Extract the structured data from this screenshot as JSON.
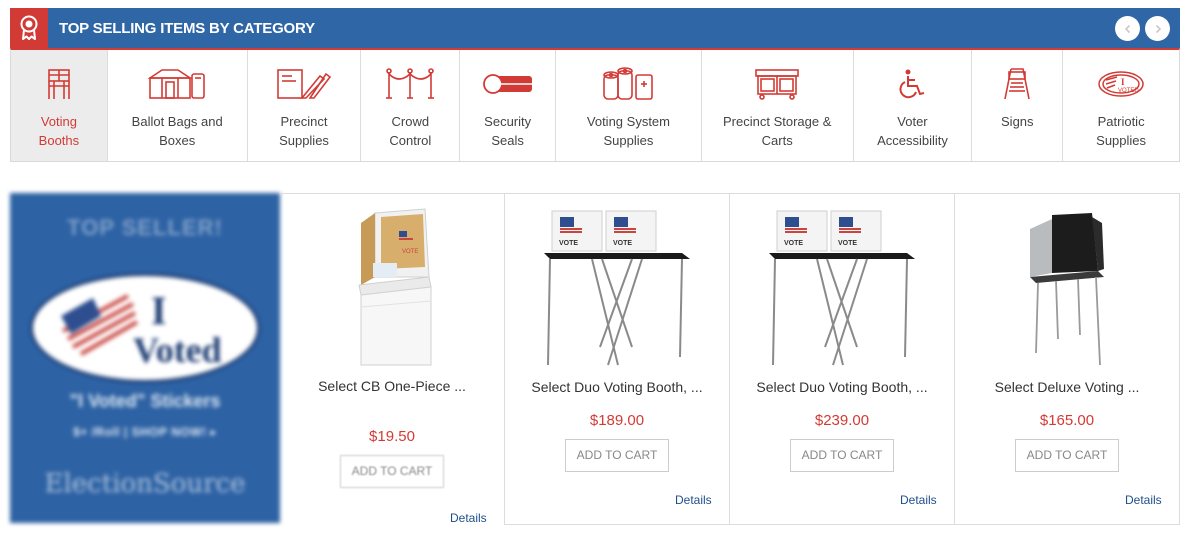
{
  "header": {
    "title": "TOP SELLING ITEMS BY CATEGORY",
    "badge_icon": "award-ribbon-icon",
    "prev_icon": "chevron-left-icon",
    "next_icon": "chevron-right-icon"
  },
  "colors": {
    "brand_blue": "#2f66a6",
    "accent_red": "#d23b35",
    "active_bg": "#ececec"
  },
  "categories": [
    {
      "label": "Voting\nBooths",
      "icon": "voting-booth-icon",
      "active": true
    },
    {
      "label": "Ballot Bags and\nBoxes",
      "icon": "ballot-box-icon",
      "active": false
    },
    {
      "label": "Precinct\nSupplies",
      "icon": "pen-clipboard-icon",
      "active": false
    },
    {
      "label": "Crowd\nControl",
      "icon": "stanchion-icon",
      "active": false
    },
    {
      "label": "Security\nSeals",
      "icon": "seal-icon",
      "active": false
    },
    {
      "label": "Voting System\nSupplies",
      "icon": "paper-roll-icon",
      "active": false
    },
    {
      "label": "Precinct Storage &\nCarts",
      "icon": "storage-cart-icon",
      "active": false
    },
    {
      "label": "Voter\nAccessibility",
      "icon": "wheelchair-icon",
      "active": false
    },
    {
      "label": "Signs",
      "icon": "vote-sign-icon",
      "active": false
    },
    {
      "label": "Patriotic\nSupplies",
      "icon": "i-voted-sticker-icon",
      "active": false
    }
  ],
  "promo": {
    "top_text": "TOP SELLER!",
    "sticker_line1": "I",
    "sticker_line2": "Voted",
    "subtitle": "\"I Voted\" Stickers",
    "shop_text": "$+ /Roll | SHOP NOW! ▸",
    "brand": "ElectionSource"
  },
  "products": [
    {
      "name": "Select CB One-Piece ...",
      "price": "$19.50",
      "button": "ADD TO CART",
      "details": "Details",
      "image": "cardboard-booth"
    },
    {
      "name": "Select Duo Voting Booth, ...",
      "price": "$189.00",
      "button": "ADD TO CART",
      "details": "Details",
      "image": "duo-booth"
    },
    {
      "name": "Select Duo Voting Booth, ...",
      "price": "$239.00",
      "button": "ADD TO CART",
      "details": "Details",
      "image": "duo-booth"
    },
    {
      "name": "Select Deluxe Voting ...",
      "price": "$165.00",
      "button": "ADD TO CART",
      "details": "Details",
      "image": "deluxe-booth"
    }
  ],
  "booth_label": "VOTE"
}
